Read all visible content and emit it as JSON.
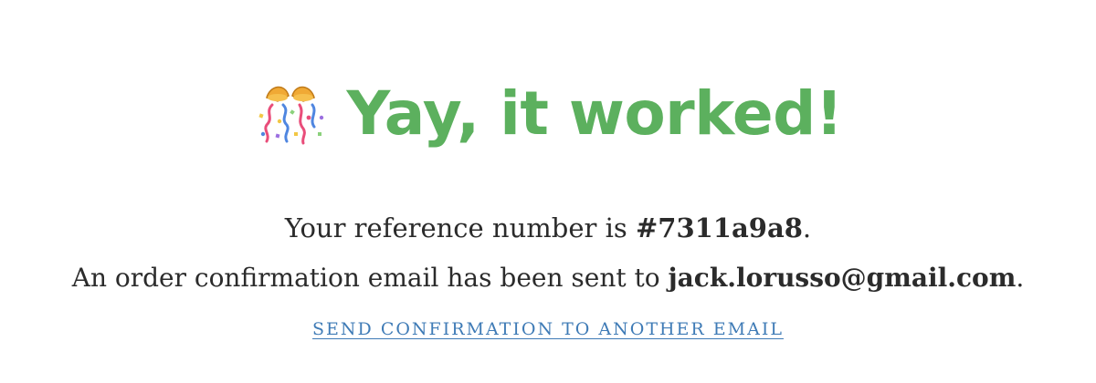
{
  "colors": {
    "headline": "#5cb05e",
    "text": "#2b2b2b",
    "link": "#3f7bb6",
    "confetti_cone": "#f0a935"
  },
  "headline": {
    "icon": "party-popper-icon",
    "text": "Yay, it worked!"
  },
  "confirmation": {
    "reference_prefix": "Your reference number is ",
    "reference_number": "#7311a9a8",
    "reference_suffix": ".",
    "email_prefix": "An order confirmation email has been sent to ",
    "email": "jack.lorusso@gmail.com",
    "email_suffix": "."
  },
  "actions": {
    "resend_link": "SEND CONFIRMATION TO ANOTHER EMAIL"
  }
}
